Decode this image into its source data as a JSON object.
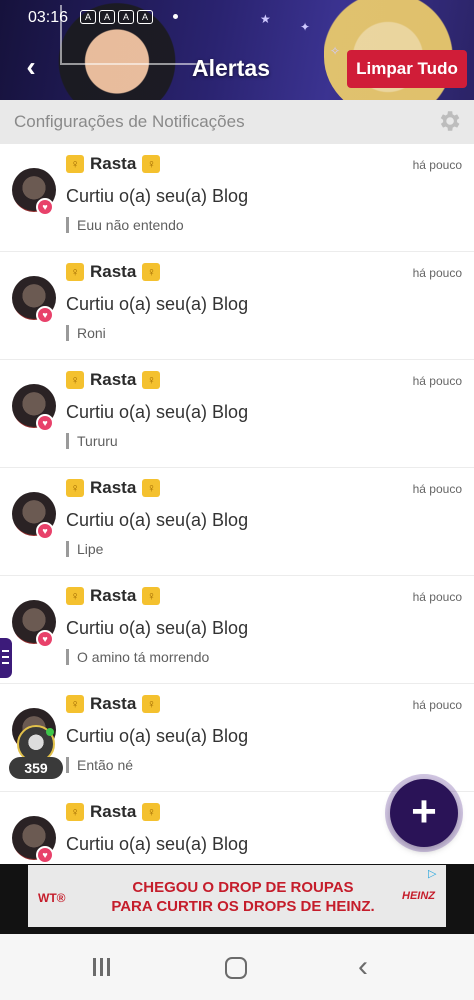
{
  "status_bar": {
    "time": "03:16",
    "icons": [
      "A",
      "A",
      "A",
      "A"
    ]
  },
  "header": {
    "title": "Alertas",
    "clear_label": "Limpar Tudo"
  },
  "settings": {
    "label": "Configurações de Notificações"
  },
  "notifications": [
    {
      "user": "Rasta",
      "time": "há pouco",
      "action": "Curtiu o(a) seu(a) Blog",
      "excerpt": "Euu não entendo"
    },
    {
      "user": "Rasta",
      "time": "há pouco",
      "action": "Curtiu o(a) seu(a) Blog",
      "excerpt": "Roni"
    },
    {
      "user": "Rasta",
      "time": "há pouco",
      "action": "Curtiu o(a) seu(a) Blog",
      "excerpt": "Tururu"
    },
    {
      "user": "Rasta",
      "time": "há pouco",
      "action": "Curtiu o(a) seu(a) Blog",
      "excerpt": "Lipe"
    },
    {
      "user": "Rasta",
      "time": "há pouco",
      "action": "Curtiu o(a) seu(a) Blog",
      "excerpt": "O amino tá morrendo"
    },
    {
      "user": "Rasta",
      "time": "há pouco",
      "action": "Curtiu o(a) seu(a) Blog",
      "excerpt": "Então né"
    },
    {
      "user": "Rasta",
      "time": "",
      "action": "Curtiu o(a) seu(a) Blog",
      "excerpt": ""
    }
  ],
  "user_chip": {
    "count": "359"
  },
  "fab": {
    "label": "+"
  },
  "ad": {
    "logo_left": "WT®",
    "line1": "CHEGOU O DROP DE ROUPAS",
    "line2": "PARA CURTIR OS DROPS DE HEINZ.",
    "logo_right": "HEINZ"
  },
  "icons": {
    "back": "back-arrow-icon",
    "gear": "gear-icon",
    "heart": "heart-icon",
    "badge": "title-badge-icon",
    "nav_recent": "recent-apps-icon",
    "nav_home": "home-icon",
    "nav_back": "back-icon"
  },
  "colors": {
    "header_bg": "#2a2370",
    "clear_button": "#d01d38",
    "heart": "#e8416a",
    "fab": "#2a1357",
    "badge": "#f4c12f",
    "ad_text": "#c51d2b"
  }
}
